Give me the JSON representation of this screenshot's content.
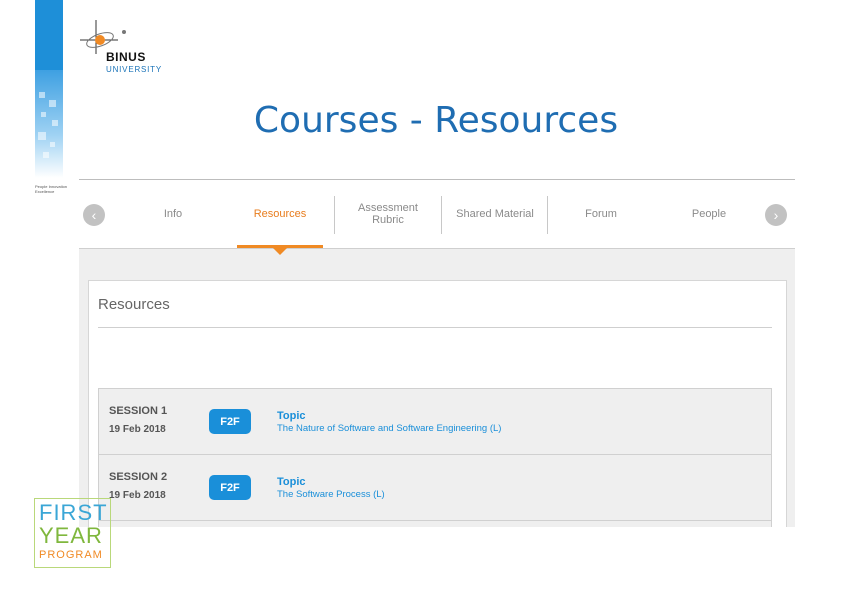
{
  "branding": {
    "logo_word": "BINUS",
    "logo_sub": "UNIVERSITY",
    "tagline": "People Innovation Excellence",
    "program_logo": [
      "FIRST",
      "YEAR",
      "PROGRAM"
    ]
  },
  "slide": {
    "title": "Courses - Resources"
  },
  "nav": {
    "prev_icon": "chevron-left-icon",
    "next_icon": "chevron-right-icon",
    "tabs": [
      {
        "label": "Info",
        "active": false
      },
      {
        "label": "Resources",
        "active": true
      },
      {
        "label": "Assessment Rubric",
        "active": false
      },
      {
        "label": "Shared Material",
        "active": false
      },
      {
        "label": "Forum",
        "active": false
      },
      {
        "label": "People",
        "active": false
      }
    ]
  },
  "resources": {
    "heading": "Resources",
    "sessions": [
      {
        "name": "SESSION 1",
        "date": "19 Feb 2018",
        "badge": "F2F",
        "topic_label": "Topic",
        "topic_title": "The Nature of Software and Software Engineering (L)"
      },
      {
        "name": "SESSION 2",
        "date": "19 Feb 2018",
        "badge": "F2F",
        "topic_label": "Topic",
        "topic_title": "The Software Process (L)"
      }
    ]
  },
  "colors": {
    "accent": "#1a8fd9",
    "active_tab": "#e87d1e",
    "title": "#1f6db2"
  }
}
